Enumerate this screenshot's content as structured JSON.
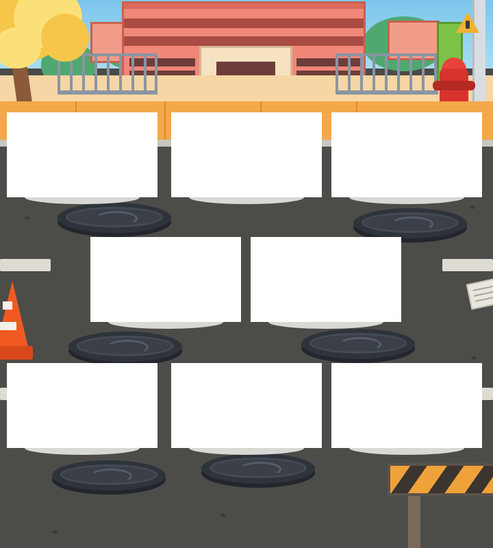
{
  "scene": {
    "name": "street-in-front-of-school",
    "palette": {
      "road": "#4c4c49",
      "sidewalk": "#f3a84a",
      "school_wall": "#f08778",
      "card": "#ffffff",
      "manhole": "#2f333b",
      "cone": "#f05a22",
      "hydrant": "#d8332c"
    }
  },
  "board": {
    "layout_rows": [
      3,
      2,
      3
    ],
    "slots": [
      {
        "id": "slot-1",
        "content": ""
      },
      {
        "id": "slot-2",
        "content": ""
      },
      {
        "id": "slot-3",
        "content": ""
      },
      {
        "id": "slot-4",
        "content": ""
      },
      {
        "id": "slot-5",
        "content": ""
      },
      {
        "id": "slot-6",
        "content": ""
      },
      {
        "id": "slot-7",
        "content": ""
      },
      {
        "id": "slot-8",
        "content": ""
      }
    ],
    "manhole_count": 6
  },
  "props": {
    "icons": [
      "tree-icon",
      "fire-hydrant-icon",
      "warning-sign-icon",
      "traffic-cone-icon",
      "newspaper-icon",
      "road-barrier-icon",
      "manhole-cover-icon",
      "fence-icon",
      "school-building-icon"
    ]
  }
}
